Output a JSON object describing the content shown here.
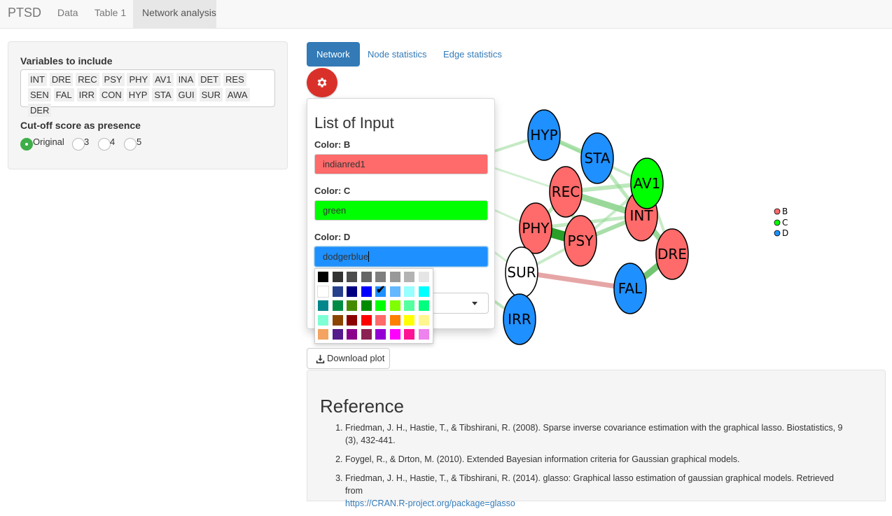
{
  "navbar": {
    "brand": "PTSD",
    "tabs": [
      {
        "label": "Data"
      },
      {
        "label": "Table 1"
      },
      {
        "label": "Network analysis"
      }
    ]
  },
  "sidebar": {
    "variables_label": "Variables to include",
    "variables": [
      "INT",
      "DRE",
      "REC",
      "PSY",
      "PHY",
      "AV1",
      "INA",
      "DET",
      "RES",
      "SEN",
      "FAL",
      "IRR",
      "CON",
      "HYP",
      "STA",
      "GUI",
      "SUR",
      "AWA",
      "DER"
    ],
    "cutoff_label": "Cut-off score as presence",
    "cutoff_options": [
      "Original",
      "3",
      "4",
      "5"
    ],
    "cutoff_selected": "Original"
  },
  "main_tabs": [
    {
      "label": "Network"
    },
    {
      "label": "Node statistics"
    },
    {
      "label": "Edge statistics"
    }
  ],
  "settings_icon": "gear-icon",
  "panel": {
    "title": "List of Input",
    "color_b_label": "Color: B",
    "color_b_value": "indianred1",
    "color_c_label": "Color: C",
    "color_c_value": "green",
    "color_d_label": "Color: D",
    "color_d_value": "dodgerblue"
  },
  "colors": {
    "B": "#ff6a6a",
    "C": "#00ff00",
    "D": "#1e90ff",
    "accent": "#337ab7",
    "gear_button": "#d9312a"
  },
  "palette": [
    [
      "#000000",
      "#333333",
      "#4d4d4d",
      "#666666",
      "#7f7f7f",
      "#999999",
      "#b3b3b3",
      "#e5e5e5"
    ],
    [
      "#ffffff",
      "#27408b",
      "#000080",
      "#0000ff",
      "#1e90ff",
      "#63b8ff",
      "#97ffff",
      "#00ffff"
    ],
    [
      "#00868b",
      "#008b45",
      "#458b00",
      "#008b00",
      "#00ff00",
      "#7fff00",
      "#54ff9f",
      "#00ff7f"
    ],
    [
      "#7fffd4",
      "#8b4500",
      "#8b0000",
      "#ff0000",
      "#ff6a6a",
      "#ff7f00",
      "#ffff00",
      "#fff68f"
    ],
    [
      "#f4a460",
      "#551a8b",
      "#8b008b",
      "#8b2252",
      "#9400d3",
      "#ff00ff",
      "#ff1493",
      "#ee82ee"
    ]
  ],
  "palette_selected": "#1e90ff",
  "network": {
    "nodes": [
      {
        "id": "HYP",
        "group": "D"
      },
      {
        "id": "STA",
        "group": "D"
      },
      {
        "id": "REC",
        "group": "B"
      },
      {
        "id": "AV1",
        "group": "C"
      },
      {
        "id": "INT",
        "group": "B"
      },
      {
        "id": "PHY",
        "group": "B"
      },
      {
        "id": "PSY",
        "group": "B"
      },
      {
        "id": "DRE",
        "group": "B"
      },
      {
        "id": "SUR",
        "group": "none"
      },
      {
        "id": "FAL",
        "group": "D"
      },
      {
        "id": "IRR",
        "group": "D"
      }
    ],
    "legend": [
      {
        "label": "B",
        "color": "#ff6a6a"
      },
      {
        "label": "C",
        "color": "#00ff00"
      },
      {
        "label": "D",
        "color": "#1e90ff"
      }
    ]
  },
  "download_label": "Download plot",
  "download_icon": "download-icon",
  "reference": {
    "title": "Reference",
    "items": [
      {
        "text": "Friedman, J. H., Hastie, T., & Tibshirani, R. (2008). Sparse inverse covariance estimation with the graphical lasso. Biostatistics, 9 (3), 432-441."
      },
      {
        "text": "Foygel, R., & Drton, M. (2010). Extended Bayesian information criteria for Gaussian graphical models."
      },
      {
        "text": "Friedman, J. H., Hastie, T., & Tibshirani, R. (2014). glasso: Graphical lasso estimation of gaussian graphical models. Retrieved from",
        "link": "https://CRAN.R-project.org/package=glasso"
      }
    ]
  }
}
